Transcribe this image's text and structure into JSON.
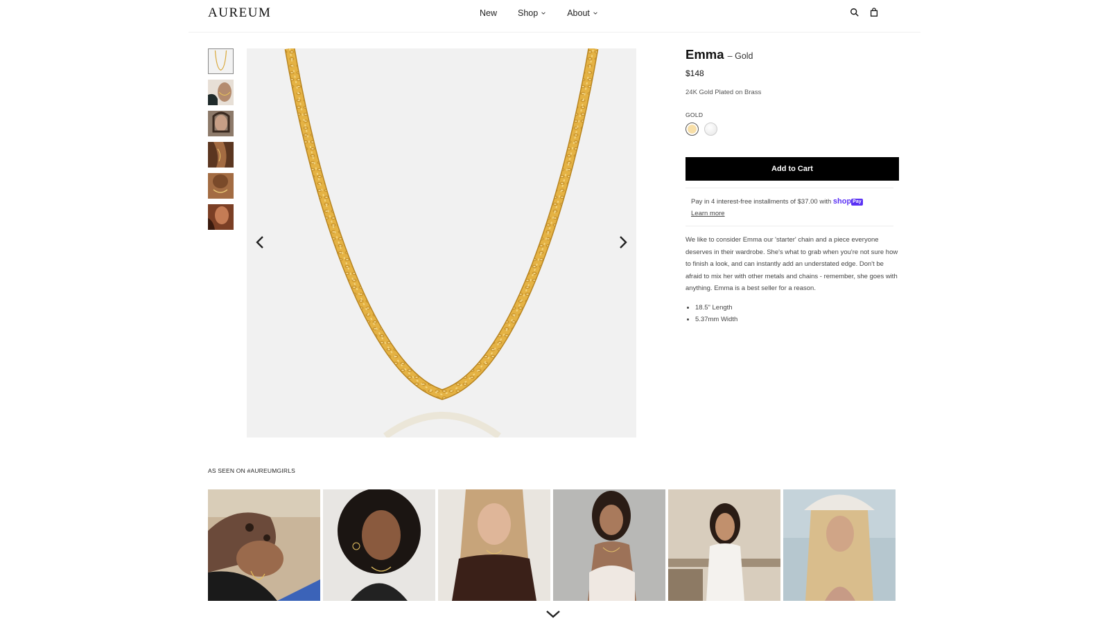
{
  "header": {
    "logo": "AUREUM",
    "nav": [
      {
        "label": "New",
        "has_dropdown": false
      },
      {
        "label": "Shop",
        "has_dropdown": true
      },
      {
        "label": "About",
        "has_dropdown": true
      }
    ],
    "icons": [
      "search-icon",
      "bag-icon"
    ]
  },
  "gallery": {
    "thumbnails": [
      "necklace-product",
      "model-neck",
      "model-portrait",
      "model-closeup",
      "model-chain",
      "model-warm"
    ],
    "selected_index": 0,
    "prev_icon": "chevron-left-icon",
    "next_icon": "chevron-right-icon"
  },
  "product": {
    "name": "Emma",
    "variant": "– Gold",
    "price": "$148",
    "material": "24K Gold Plated on Brass",
    "option_label": "GOLD",
    "swatches": [
      {
        "name": "Gold",
        "color": "#f8dfa8",
        "selected": true
      },
      {
        "name": "Silver",
        "color": "#eeeeee",
        "selected": false
      }
    ],
    "add_to_cart": "Add to Cart",
    "installments_text": "Pay in 4 interest-free installments of $37.00 with",
    "shoppay_label": "shop",
    "shoppay_badge": "Pay",
    "learn_more": "Learn more",
    "description": "We like to consider Emma our 'starter' chain and a piece everyone deserves in their wardrobe. She's what to grab when you're not sure how to finish a look, and can instantly add an understated edge. Don't be afraid to mix her with other metals and chains - remember, she goes with anything. Emma is a best seller for a reason.",
    "specs": [
      "18.5\" Length",
      "5.37mm Width"
    ]
  },
  "social": {
    "heading": "AS SEEN ON #AUREUMGIRLS",
    "photos": [
      "beach-bucket-hat",
      "curly-hair-portrait",
      "blonde-blazer",
      "white-top-studio",
      "white-tee-wood",
      "beach-hat-blonde"
    ]
  },
  "colors": {
    "accent": "#000000",
    "gold": "#e9b949",
    "shoppay": "#5a31f4"
  }
}
